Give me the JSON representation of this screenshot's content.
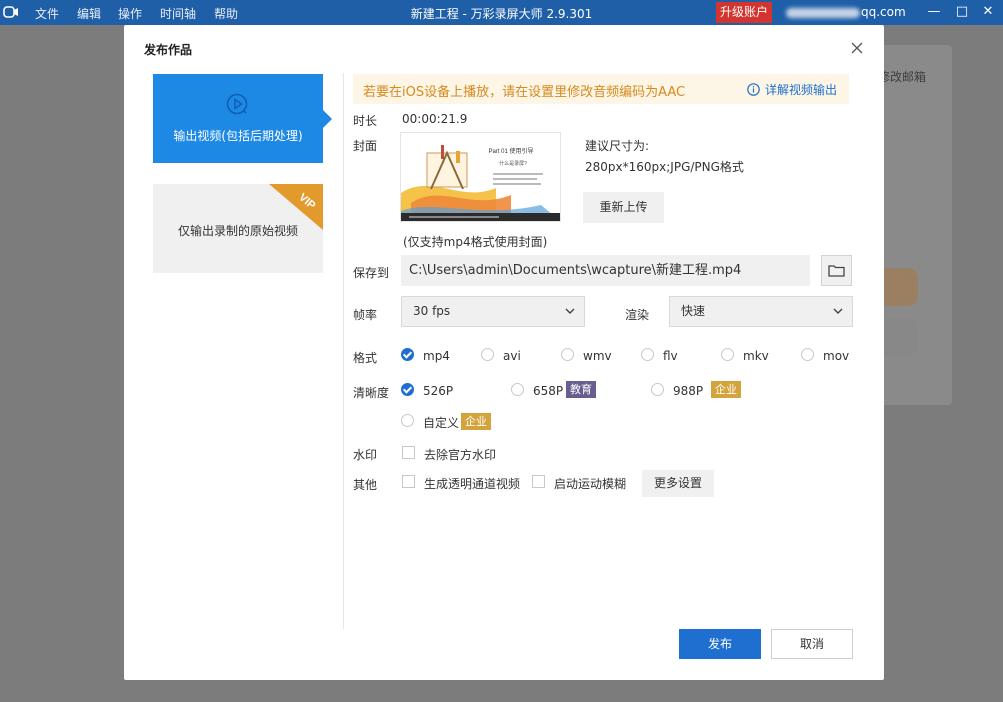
{
  "titlebar": {
    "menus": [
      "文件",
      "编辑",
      "操作",
      "时间轴",
      "帮助"
    ],
    "title": "新建工程 - 万彩录屏大师 2.9.301",
    "upgrade": "升级账户",
    "account": "qq.com"
  },
  "background": {
    "edit_mail": "修改邮箱"
  },
  "dialog": {
    "title": "发布作品",
    "side": {
      "selected_label": "输出视频(包括后期处理)",
      "raw_label": "仅输出录制的原始视频",
      "vip": "VIP"
    },
    "notice": {
      "text": "若要在iOS设备上播放，请在设置里修改音频编码为AAC",
      "link": "详解视频输出"
    },
    "duration": {
      "label": "时长",
      "value": "00:00:21.9"
    },
    "cover": {
      "label": "封面",
      "hint_title": "建议尺寸为:",
      "hint_size": "280px*160px;JPG/PNG格式",
      "reupload": "重新上传",
      "note": "(仅支持mp4格式使用封面)"
    },
    "save": {
      "label": "保存到",
      "path": "C:\\Users\\admin\\Documents\\wcapture\\新建工程.mp4"
    },
    "fps": {
      "label": "帧率",
      "value": "30 fps"
    },
    "render": {
      "label": "渲染",
      "value": "快速"
    },
    "format": {
      "label": "格式",
      "options": [
        "mp4",
        "avi",
        "wmv",
        "flv",
        "mkv",
        "mov"
      ],
      "selected": "mp4"
    },
    "resolution": {
      "label": "清晰度",
      "options": [
        "526P",
        "658P",
        "988P",
        "自定义"
      ],
      "badges": [
        "教育",
        "企业",
        "企业"
      ],
      "selected": "526P"
    },
    "watermark": {
      "label": "水印",
      "option": "去除官方水印"
    },
    "other": {
      "label": "其他",
      "alpha": "生成透明通道视频",
      "motion_blur": "启动运动模糊",
      "more": "更多设置"
    },
    "buttons": {
      "publish": "发布",
      "cancel": "取消"
    }
  }
}
